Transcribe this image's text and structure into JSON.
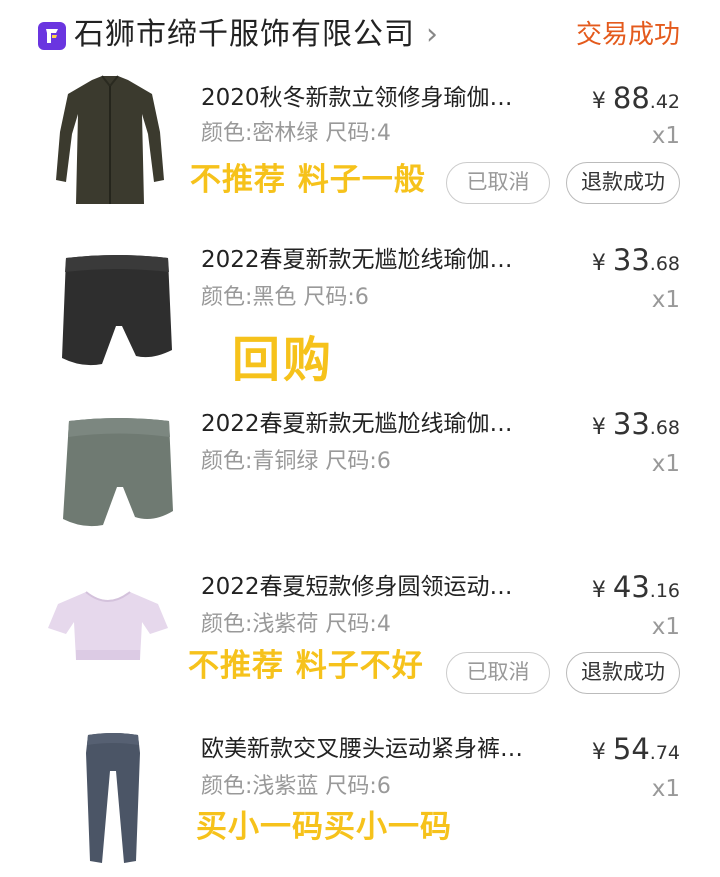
{
  "shop": {
    "name": "石狮市缔千服饰有限公司",
    "status": "交易成功"
  },
  "items": [
    {
      "title": "2020秋冬新款立领修身瑜伽…",
      "spec": "颜色:密林绿 尺码:4",
      "price_int": "88",
      "price_dec": ".42",
      "currency": "¥",
      "qty": "x1",
      "note": "不推荐 料子一般",
      "btn_cancel": "已取消",
      "btn_refund": "退款成功"
    },
    {
      "title": "2022春夏新款无尴尬线瑜伽…",
      "spec": "颜色:黑色 尺码:6",
      "price_int": "33",
      "price_dec": ".68",
      "currency": "¥",
      "qty": "x1",
      "note": "回购"
    },
    {
      "title": "2022春夏新款无尴尬线瑜伽…",
      "spec": "颜色:青铜绿 尺码:6",
      "price_int": "33",
      "price_dec": ".68",
      "currency": "¥",
      "qty": "x1"
    },
    {
      "title": "2022春夏短款修身圆领运动…",
      "spec": "颜色:浅紫荷 尺码:4",
      "price_int": "43",
      "price_dec": ".16",
      "currency": "¥",
      "qty": "x1",
      "note": "不推荐 料子不好",
      "btn_cancel": "已取消",
      "btn_refund": "退款成功"
    },
    {
      "title": "欧美新款交叉腰头运动紧身裤…",
      "spec": "颜色:浅紫蓝 尺码:6",
      "price_int": "54",
      "price_dec": ".74",
      "currency": "¥",
      "qty": "x1",
      "note": "买小一码买小一码"
    }
  ]
}
